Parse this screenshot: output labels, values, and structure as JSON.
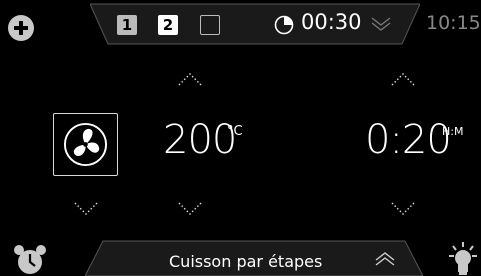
{
  "top_bar": {
    "steps": [
      {
        "label": "1",
        "state": "inactive"
      },
      {
        "label": "2",
        "state": "selected"
      },
      {
        "label": "",
        "state": "empty"
      }
    ],
    "timer_icon": "pie-timer-icon",
    "timer_value": "00:30",
    "expand_icon": "chevron-down-icon",
    "clock": "10:15",
    "add_icon": "plus-circle-icon"
  },
  "main": {
    "mode_icon": "fan-icon",
    "temperature": {
      "value": "200",
      "unit": "°C"
    },
    "duration": {
      "value": "0:20",
      "unit": "H:M"
    }
  },
  "bottom_bar": {
    "label": "Cuisson par étapes",
    "alarm_icon": "alarm-clock-icon",
    "expand_icon": "chevron-up-icon",
    "light_icon": "oven-light-icon"
  },
  "colors": {
    "background": "#000000",
    "bar_fill": "#1a1a1a",
    "text": "#ffffff",
    "dim_text": "#888888"
  }
}
